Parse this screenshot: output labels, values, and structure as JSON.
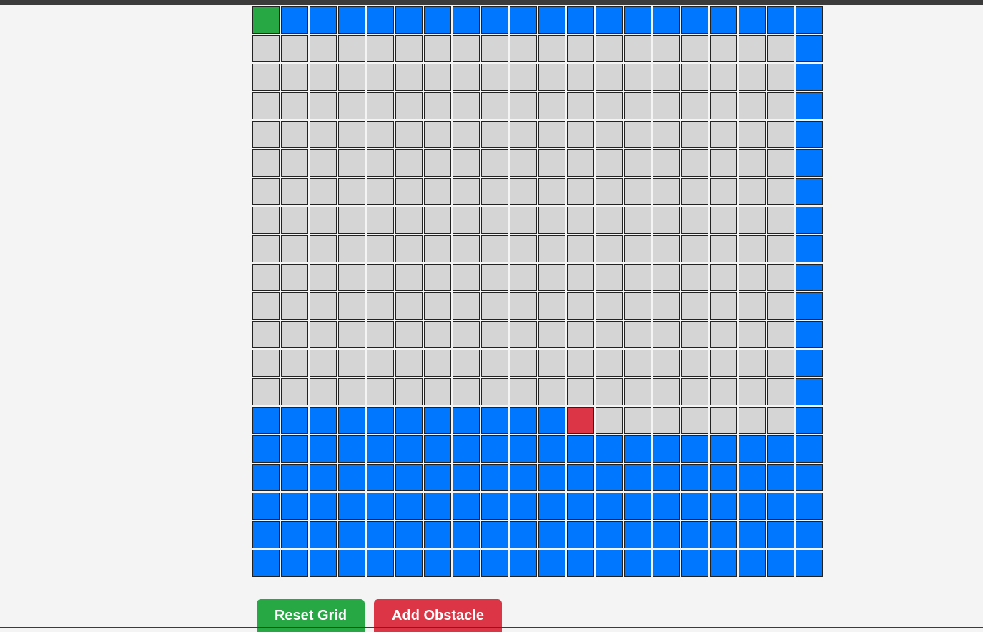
{
  "colors": {
    "background": "#f4f4f4",
    "empty": "#d5d5d5",
    "path": "#0077ff",
    "start": "#28a745",
    "end": "#dc3545",
    "cell_border": "#222222"
  },
  "grid": {
    "rows": 20,
    "cols": 20,
    "legend": {
      "S": "start",
      "E": "end",
      "P": "path",
      ".": "empty"
    },
    "cells": [
      "SPPPPPPPPPPPPPPPPPPP",
      "...................P",
      "...................P",
      "...................P",
      "...................P",
      "...................P",
      "...................P",
      "...................P",
      "...................P",
      "...................P",
      "...................P",
      "...................P",
      "...................P",
      "...................P",
      "PPPPPPPPPPPE.......P",
      "PPPPPPPPPPPPPPPPPPPP",
      "PPPPPPPPPPPPPPPPPPPP",
      "PPPPPPPPPPPPPPPPPPPP",
      "PPPPPPPPPPPPPPPPPPPP",
      "PPPPPPPPPPPPPPPPPPPP"
    ]
  },
  "buttons": {
    "reset": {
      "label": "Reset Grid",
      "color": "#28a745"
    },
    "obstacle": {
      "label": "Add Obstacle",
      "color": "#dc3545"
    }
  }
}
